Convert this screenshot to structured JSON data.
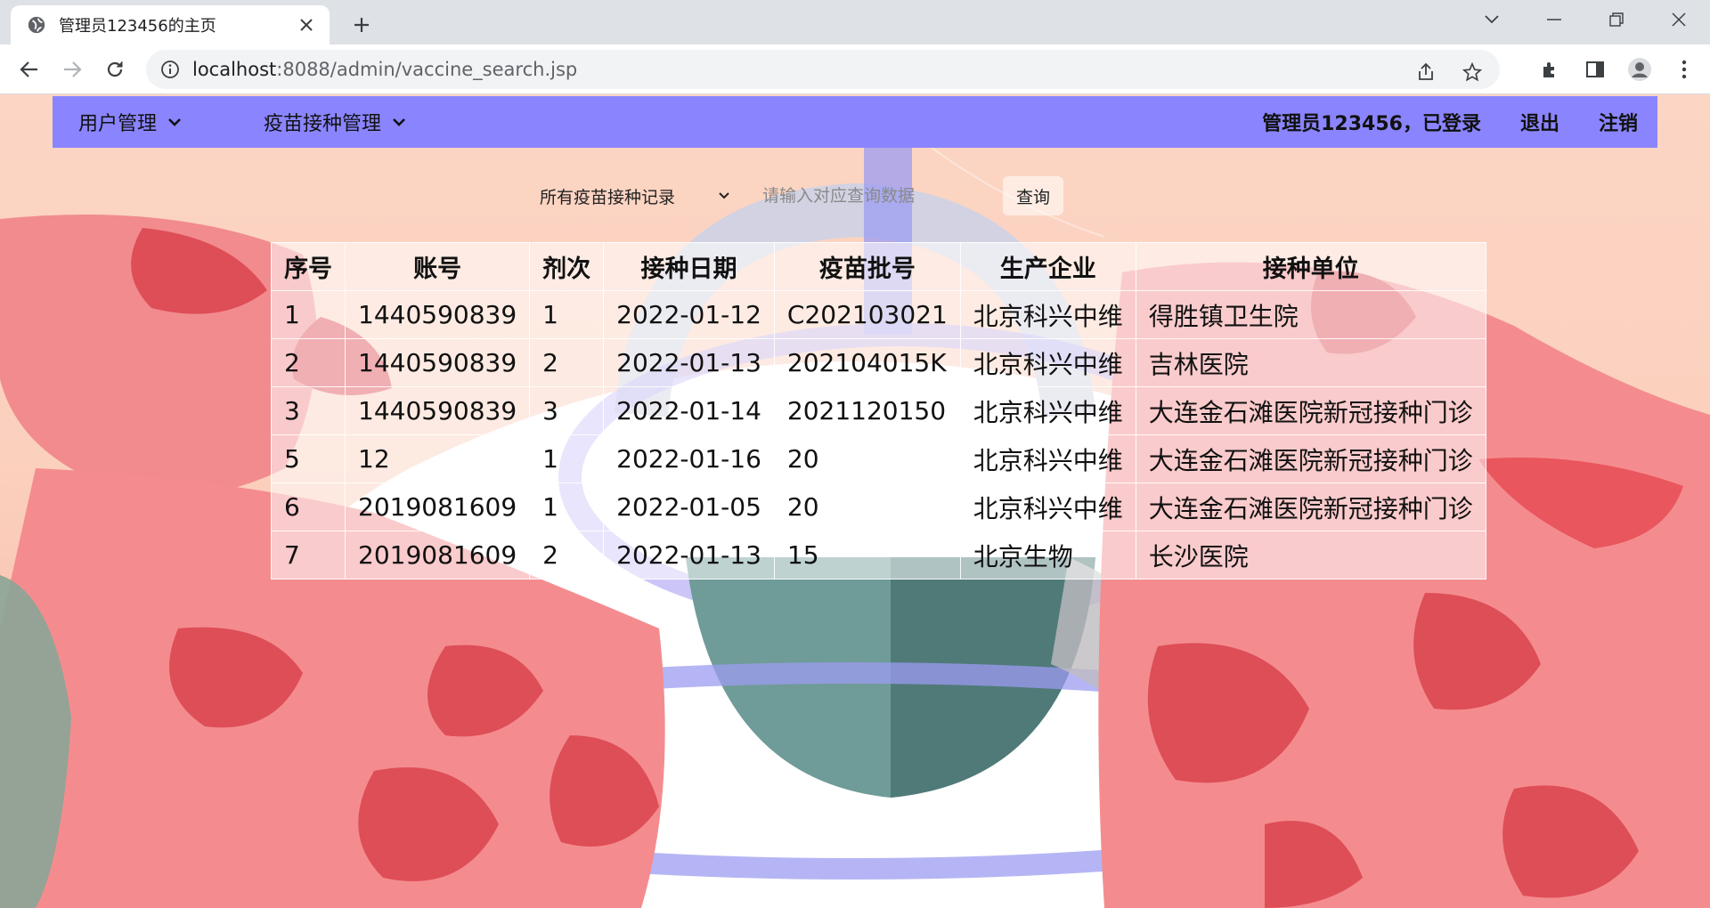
{
  "browser": {
    "tab_title": "管理员123456的主页",
    "url_host": "localhost",
    "url_rest": ":8088/admin/vaccine_search.jsp"
  },
  "nav": {
    "menu_user": "用户管理",
    "menu_vaccine": "疫苗接种管理",
    "status": "管理员123456，已登录",
    "logout": "退出",
    "cancel_account": "注销",
    "bar_color": "#8a85ff"
  },
  "search": {
    "selected_option": "所有疫苗接种记录",
    "placeholder": "请输入对应查询数据",
    "button_label": "查询"
  },
  "table": {
    "headers": [
      "序号",
      "账号",
      "剂次",
      "接种日期",
      "疫苗批号",
      "生产企业",
      "接种单位"
    ],
    "rows": [
      [
        "1",
        "1440590839",
        "1",
        "2022-01-12",
        "C202103021",
        "北京科兴中维",
        "得胜镇卫生院"
      ],
      [
        "2",
        "1440590839",
        "2",
        "2022-01-13",
        "202104015K",
        "北京科兴中维",
        "吉林医院"
      ],
      [
        "3",
        "1440590839",
        "3",
        "2022-01-14",
        "2021120150",
        "北京科兴中维",
        "大连金石滩医院新冠接种门诊"
      ],
      [
        "5",
        "12",
        "1",
        "2022-01-16",
        "20",
        "北京科兴中维",
        "大连金石滩医院新冠接种门诊"
      ],
      [
        "6",
        "2019081609",
        "1",
        "2022-01-05",
        "20",
        "北京科兴中维",
        "大连金石滩医院新冠接种门诊"
      ],
      [
        "7",
        "2019081609",
        "2",
        "2022-01-13",
        "15",
        "北京生物",
        "长沙医院"
      ]
    ]
  }
}
